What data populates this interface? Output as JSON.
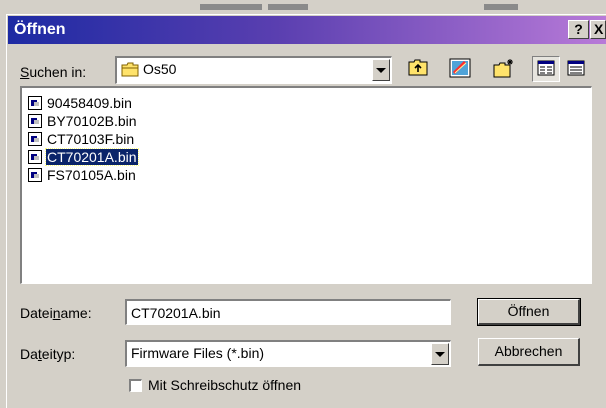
{
  "dialog": {
    "title": "Öffnen",
    "help_label": "?",
    "close_label": "X"
  },
  "look_in": {
    "label": "Suchen in:",
    "value": "Os50"
  },
  "files": [
    {
      "name": "90458409.bin",
      "selected": false
    },
    {
      "name": "BY70102B.bin",
      "selected": false
    },
    {
      "name": "CT70103F.bin",
      "selected": false
    },
    {
      "name": "CT70201A.bin",
      "selected": true
    },
    {
      "name": "FS70105A.bin",
      "selected": false
    }
  ],
  "filename": {
    "label": "Dateiname:",
    "value": "CT70201A.bin"
  },
  "filetype": {
    "label": "Dateityp:",
    "value": "Firmware Files (*.bin)"
  },
  "readonly": {
    "label": "Mit Schreibschutz öffnen",
    "checked": false
  },
  "buttons": {
    "open": "Öffnen",
    "cancel": "Abbrechen"
  },
  "icons": {
    "folder": "folder-icon",
    "up": "up-folder-icon",
    "desktop": "desktop-icon",
    "new_folder": "new-folder-icon",
    "list_view": "list-view-icon",
    "details_view": "details-view-icon",
    "file": "bin-file-icon"
  },
  "colors": {
    "title_start": "#1d2aa3",
    "title_end": "#b87ad8",
    "selection": "#0a246a",
    "face": "#d4d0c8"
  }
}
